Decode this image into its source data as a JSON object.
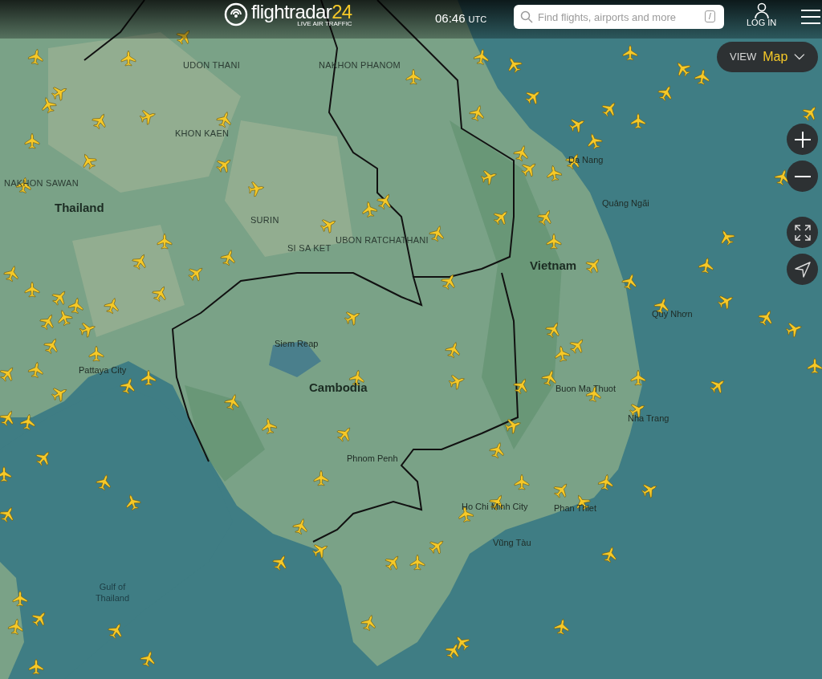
{
  "header": {
    "logo": {
      "name": "flightradar",
      "suffix": "24",
      "tagline": "LIVE AIR TRAFFIC"
    },
    "time": "06:46",
    "timezone": "UTC",
    "search": {
      "placeholder": "Find flights, airports and more",
      "shortcut": "/"
    },
    "login": "LOG IN"
  },
  "view_selector": {
    "label": "VIEW",
    "value": "Map"
  },
  "map": {
    "labels": [
      {
        "text": "UDON THANI",
        "kind": "province"
      },
      {
        "text": "NAKHON PHANOM",
        "kind": "province"
      },
      {
        "text": "KHON KAEN",
        "kind": "province"
      },
      {
        "text": "Da Nang",
        "kind": "city"
      },
      {
        "text": "NAKHON SAWAN",
        "kind": "province"
      },
      {
        "text": "Quảng Ngãi",
        "kind": "city"
      },
      {
        "text": "Thailand",
        "kind": "country"
      },
      {
        "text": "SURIN",
        "kind": "province"
      },
      {
        "text": "UBON RATCHATHANI",
        "kind": "province"
      },
      {
        "text": "SI SA KET",
        "kind": "province"
      },
      {
        "text": "Vietnam",
        "kind": "country"
      },
      {
        "text": "Quy Nhơn",
        "kind": "city"
      },
      {
        "text": "Siem Reap",
        "kind": "city"
      },
      {
        "text": "Pattaya City",
        "kind": "city"
      },
      {
        "text": "Cambodia",
        "kind": "country"
      },
      {
        "text": "Buon Ma Thuot",
        "kind": "city"
      },
      {
        "text": "Nha Trang",
        "kind": "city"
      },
      {
        "text": "Phnom Penh",
        "kind": "city"
      },
      {
        "text": "Ho Chi Minh City",
        "kind": "city"
      },
      {
        "text": "Phan Thiet",
        "kind": "city"
      },
      {
        "text": "Vũng Tàu",
        "kind": "city"
      },
      {
        "text": "Gulf of Thailand",
        "kind": "sea"
      }
    ]
  }
}
